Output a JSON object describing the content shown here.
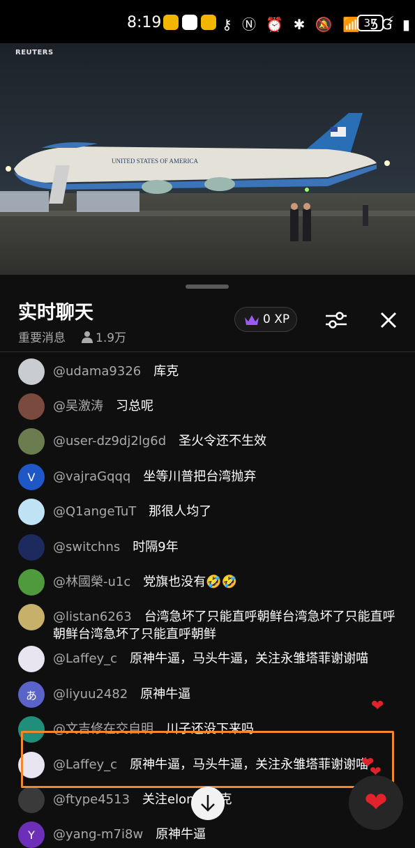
{
  "status_bar": {
    "time": "8:19",
    "icons": "⚷ Ⓝ ⏰ ✱ 🔕 📶 5G ▮",
    "battery": "37",
    "icon_names": [
      "weibo-icon",
      "qq-icon",
      "weibo-icon",
      "key-icon",
      "nfc-icon",
      "alarm-icon",
      "bluetooth-icon",
      "mute-icon",
      "wifi-icon",
      "signal-icon",
      "battery-icon",
      "charging-icon"
    ]
  },
  "video": {
    "watermark": "REUTERS",
    "plane_text": "UNITED STATES OF AMERICA"
  },
  "chat": {
    "title": "实时聊天",
    "mode": "重要消息",
    "viewers": "1.9万",
    "xp": "0 XP",
    "messages": [
      {
        "author": "@udama9326",
        "text": "库克",
        "avatar_color": "#c9cdd2",
        "avatar_letter": ""
      },
      {
        "author": "@吴激涛",
        "text": "习总呢",
        "avatar_color": "#7a4a3e",
        "avatar_letter": ""
      },
      {
        "author": "@user-dz9dj2lg6d",
        "text": "圣火令还不生效",
        "avatar_color": "#6b7d4f",
        "avatar_letter": ""
      },
      {
        "author": "@vajraGqqq",
        "text": "坐等川普把台湾抛弃",
        "avatar_color": "#1f57c7",
        "avatar_letter": "V"
      },
      {
        "author": "@Q1angeTuT",
        "text": "那很人均了",
        "avatar_color": "#bfe3f5",
        "avatar_letter": ""
      },
      {
        "author": "@switchns",
        "text": "时隔9年",
        "avatar_color": "#1c2a5e",
        "avatar_letter": ""
      },
      {
        "author": "@林國榮-u1c",
        "text": "党旗也没有🤣🤣",
        "avatar_color": "#4f9a3d",
        "avatar_letter": ""
      },
      {
        "author": "@listan6263",
        "text": "台湾急坏了只能直呼朝鲜台湾急坏了只能直呼朝鲜台湾急坏了只能直呼朝鲜",
        "avatar_color": "#c7b16a",
        "avatar_letter": ""
      },
      {
        "author": "@Laffey_c",
        "text": "原神牛逼，马头牛逼，关注永雏塔菲谢谢喵",
        "avatar_color": "#e8e4f0",
        "avatar_letter": ""
      },
      {
        "author": "@liyuu2482",
        "text": "原神牛逼",
        "avatar_color": "#5a63c8",
        "avatar_letter": "あ"
      },
      {
        "author": "@文吉修在交自明",
        "text": "川子还没下来吗",
        "avatar_color": "#1f8f7a",
        "avatar_letter": ""
      },
      {
        "author": "@Laffey_c",
        "text": "原神牛逼，马头牛逼，关注永雏塔菲谢谢喵",
        "avatar_color": "#e8e4f0",
        "avatar_letter": ""
      },
      {
        "author": "@ftype4513",
        "text": "关注elon马斯克",
        "avatar_color": "#3a3a3a",
        "avatar_letter": ""
      },
      {
        "author": "@yang-m7i8w",
        "text": "原神牛逼",
        "avatar_color": "#6d2fb8",
        "avatar_letter": "Y"
      }
    ]
  }
}
